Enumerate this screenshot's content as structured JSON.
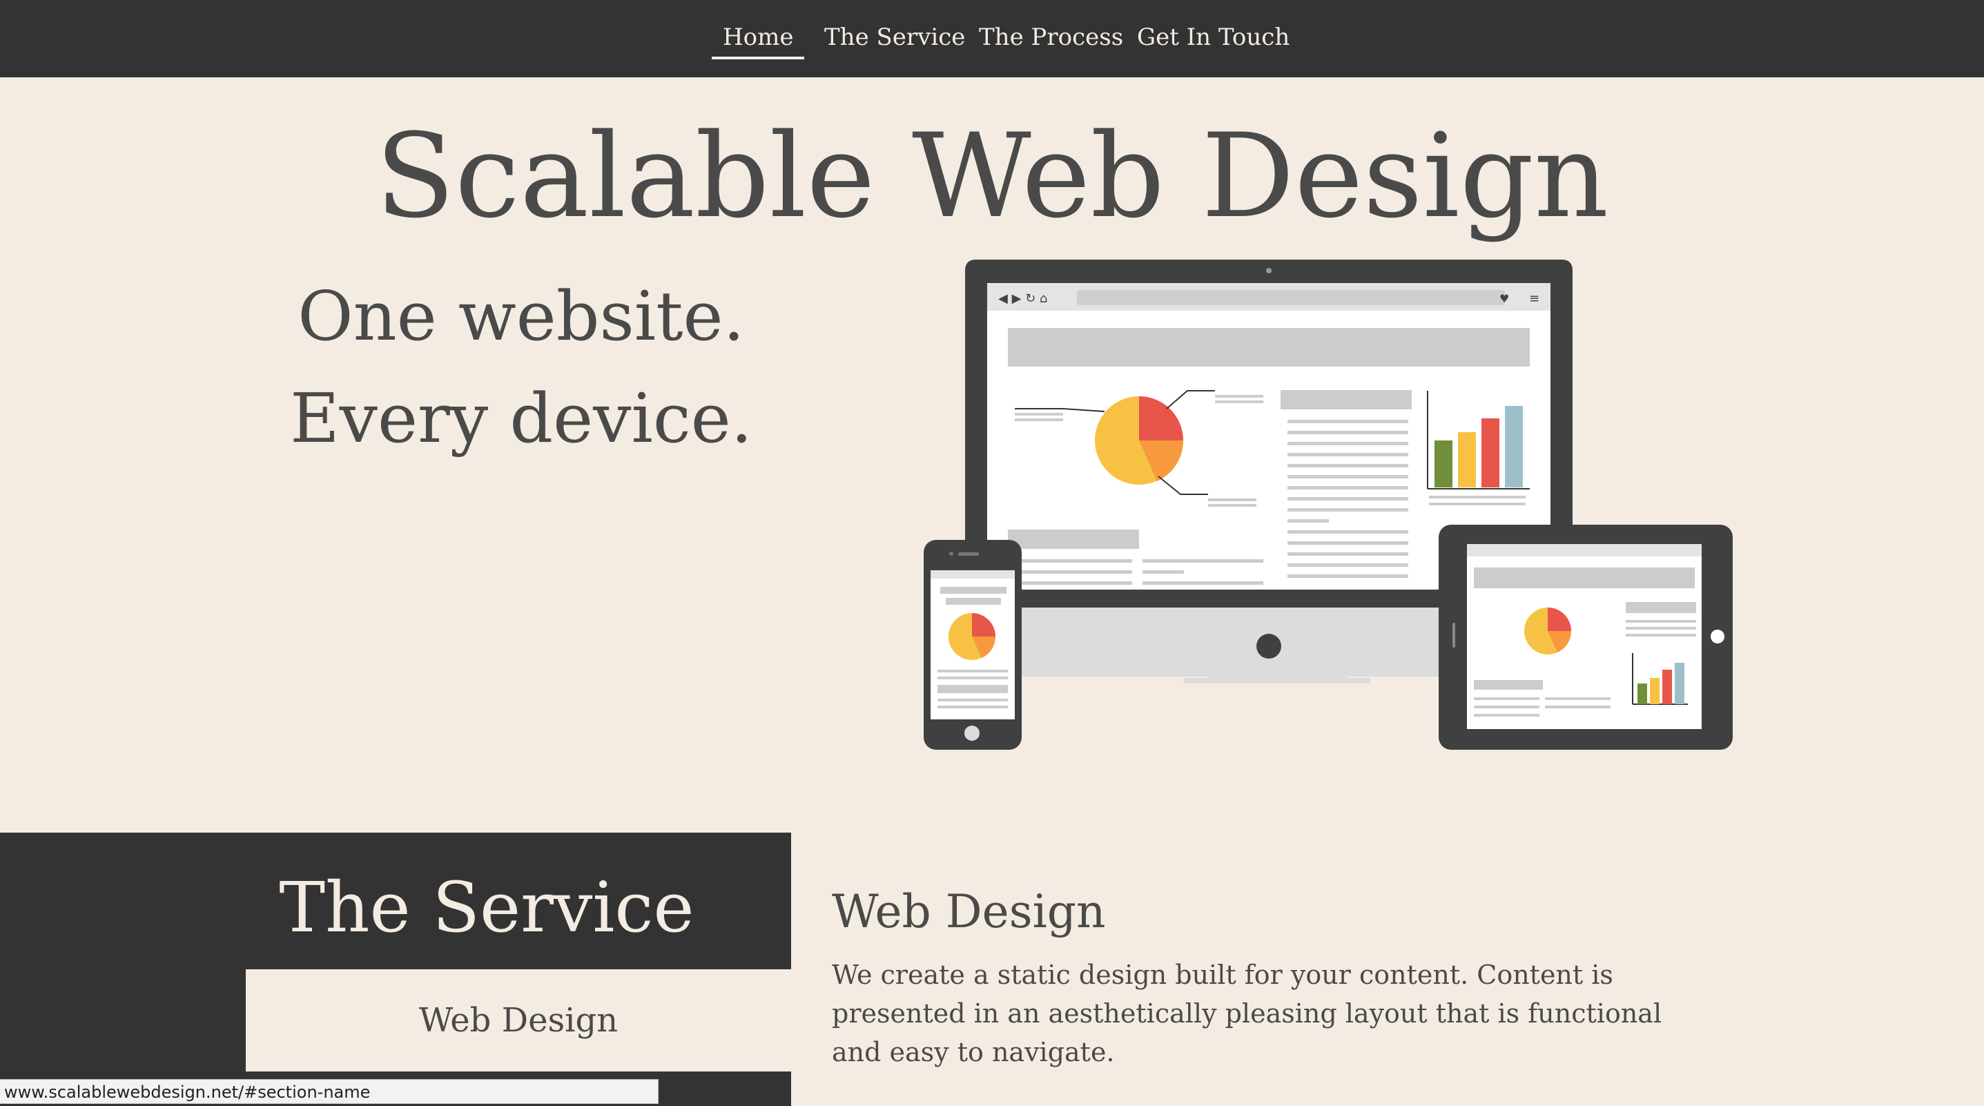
{
  "nav": {
    "items": [
      {
        "label": "Home",
        "active": true
      },
      {
        "label": "The Service",
        "active": false
      },
      {
        "label": "The Process",
        "active": false
      },
      {
        "label": "Get In Touch",
        "active": false
      }
    ]
  },
  "hero": {
    "title": "Scalable Web Design",
    "tagline": "One website. Every device."
  },
  "service": {
    "heading": "The Service",
    "active_tab": "Web Design",
    "content_title": "Web Design",
    "content_text": "We create a static design built for your content. Content is presented in an aesthetically pleasing layout that is functional and easy to navigate."
  },
  "status_bar": {
    "url": "www.scalablewebdesign.net/#section-name"
  },
  "colors": {
    "dark": "#333333",
    "cream": "#f4ece2",
    "text": "#4a4a4a",
    "pie_red": "#e8554b",
    "pie_yellow": "#f7c244",
    "pie_orange": "#f79a3e",
    "bar_green": "#6f8f3a",
    "bar_blue": "#9dbfc9"
  },
  "icons": [
    "monitor-illustration",
    "phone-illustration",
    "tablet-illustration",
    "pie-chart-icon",
    "bar-chart-icon"
  ]
}
